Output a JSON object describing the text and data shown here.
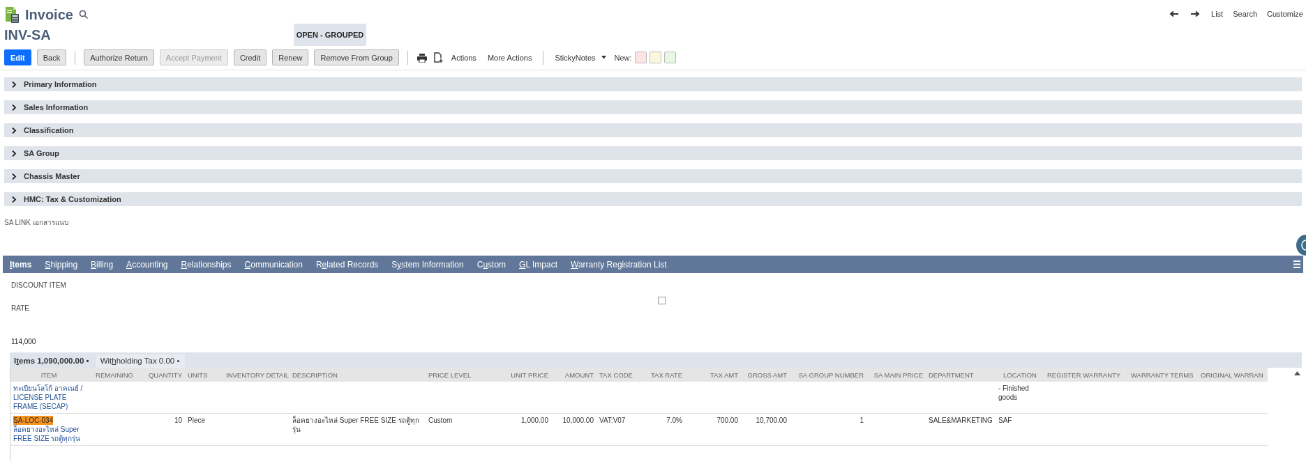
{
  "header": {
    "title": "Invoice",
    "record": "INV-SA",
    "status": "OPEN - GROUPED"
  },
  "nav_links": [
    "List",
    "Search",
    "Customize"
  ],
  "toolbar": [
    {
      "kind": "button",
      "label": "Edit",
      "primary": true,
      "disabled": false
    },
    {
      "kind": "button",
      "label": "Back",
      "primary": false,
      "disabled": false
    },
    {
      "kind": "separator"
    },
    {
      "kind": "button",
      "label": "Authorize Return",
      "primary": false,
      "disabled": false
    },
    {
      "kind": "button",
      "label": "Accept Payment",
      "primary": false,
      "disabled": true
    },
    {
      "kind": "button",
      "label": "Credit",
      "primary": false,
      "disabled": false
    },
    {
      "kind": "button",
      "label": "Renew",
      "primary": false,
      "disabled": false
    },
    {
      "kind": "button",
      "label": "Remove From Group",
      "primary": false,
      "disabled": false
    },
    {
      "kind": "separator"
    },
    {
      "kind": "print"
    },
    {
      "kind": "new_document"
    },
    {
      "kind": "link",
      "label": "Actions"
    },
    {
      "kind": "link",
      "label": "More Actions"
    },
    {
      "kind": "separator"
    }
  ],
  "sticky_notes": {
    "label": "StickyNotes",
    "new_label": "New:",
    "notes": [
      {
        "color": "#fce4e4"
      },
      {
        "color": "#fbf7dd"
      },
      {
        "color": "#e6f7e4"
      }
    ]
  },
  "sections": [
    {
      "title": "Primary Information",
      "expanded": false
    },
    {
      "title": "Sales Information",
      "expanded": false
    },
    {
      "title": "Classification",
      "expanded": false
    },
    {
      "title": "SA Group",
      "expanded": false
    },
    {
      "title": "Chassis Master",
      "expanded": false
    },
    {
      "title": "HMC: Tax & Customization",
      "expanded": false
    }
  ],
  "sa_link": "SA LINK เอกสารแนบ",
  "tabs": [
    {
      "key": "I",
      "end": "tems",
      "selected": true
    },
    {
      "key": "S",
      "end": "hipping",
      "selected": false
    },
    {
      "key": "B",
      "end": "illing",
      "selected": false
    },
    {
      "key": "A",
      "end": "ccounting",
      "selected": false
    },
    {
      "key": "R",
      "end": "elationships",
      "selected": false
    },
    {
      "key": "C",
      "end": "ommunication",
      "selected": false
    },
    {
      "start": "R",
      "key": "e",
      "end": "lated Records",
      "selected": false
    },
    {
      "start": "S",
      "key": "y",
      "end": "stem Information",
      "selected": false
    },
    {
      "start": "C",
      "key": "u",
      "end": "stom",
      "selected": false
    },
    {
      "key": "G",
      "end": "L Impact",
      "selected": false
    },
    {
      "key": "W",
      "end": "arranty Registration List",
      "selected": false
    }
  ],
  "fields": {
    "discount_item": "DISCOUNT ITEM",
    "rate": "RATE",
    "checkbox": {
      "checked": false
    },
    "value": "114,000"
  },
  "subtabs": [
    {
      "start": "I",
      "key": "t",
      "end": "ems 1,090,000.00 •",
      "selected": true
    },
    {
      "start": "Wit",
      "key": "h",
      "end": "holding Tax 0.00 •",
      "selected": false
    }
  ],
  "table": {
    "columns": [
      "ITEM",
      "REMAINING",
      "QUANTITY",
      "UNITS",
      "INVENTORY DETAIL",
      "DESCRIPTION",
      "PRICE LEVEL",
      "UNIT PRICE",
      "AMOUNT",
      "TAX CODE",
      "TAX RATE",
      "TAX AMT",
      "GROSS AMT",
      "SA GROUP NUMBER",
      "SA MAIN PRICE",
      "DEPARTMENT",
      "LOCATION",
      "REGISTER WARRANTY",
      "WARRANTY TERMS",
      "ORIGINAL WARRAN"
    ],
    "rows": [
      {
        "item_text": "ทะเบียนโลโก้ อาคเนย์ / LICENSE PLATE FRAME (SECAP)",
        "cells": [
          null,
          null,
          null,
          null,
          null,
          null,
          null,
          null,
          null,
          null,
          null,
          null,
          null,
          null,
          null,
          null,
          "- Finished goods",
          null,
          null,
          null
        ]
      },
      {
        "item_code": "SA-LOC-034",
        "item_code_highlighted": true,
        "item_text": "ล็อคยางอะไหล่ Super FREE SIZE รถตู้ทุกรุ่น",
        "cells": [
          null,
          null,
          "10",
          "Piece",
          null,
          "ล็อคยางอะไหล่ Super FREE SIZE รถตู้ทุกรุ่น",
          "Custom",
          "1,000.00",
          "10,000.00",
          "VAT:V07",
          "7.0%",
          "700.00",
          "10,700.00",
          "1",
          null,
          "SALE&MARKETING",
          "SAF",
          null,
          null,
          null
        ]
      }
    ]
  }
}
